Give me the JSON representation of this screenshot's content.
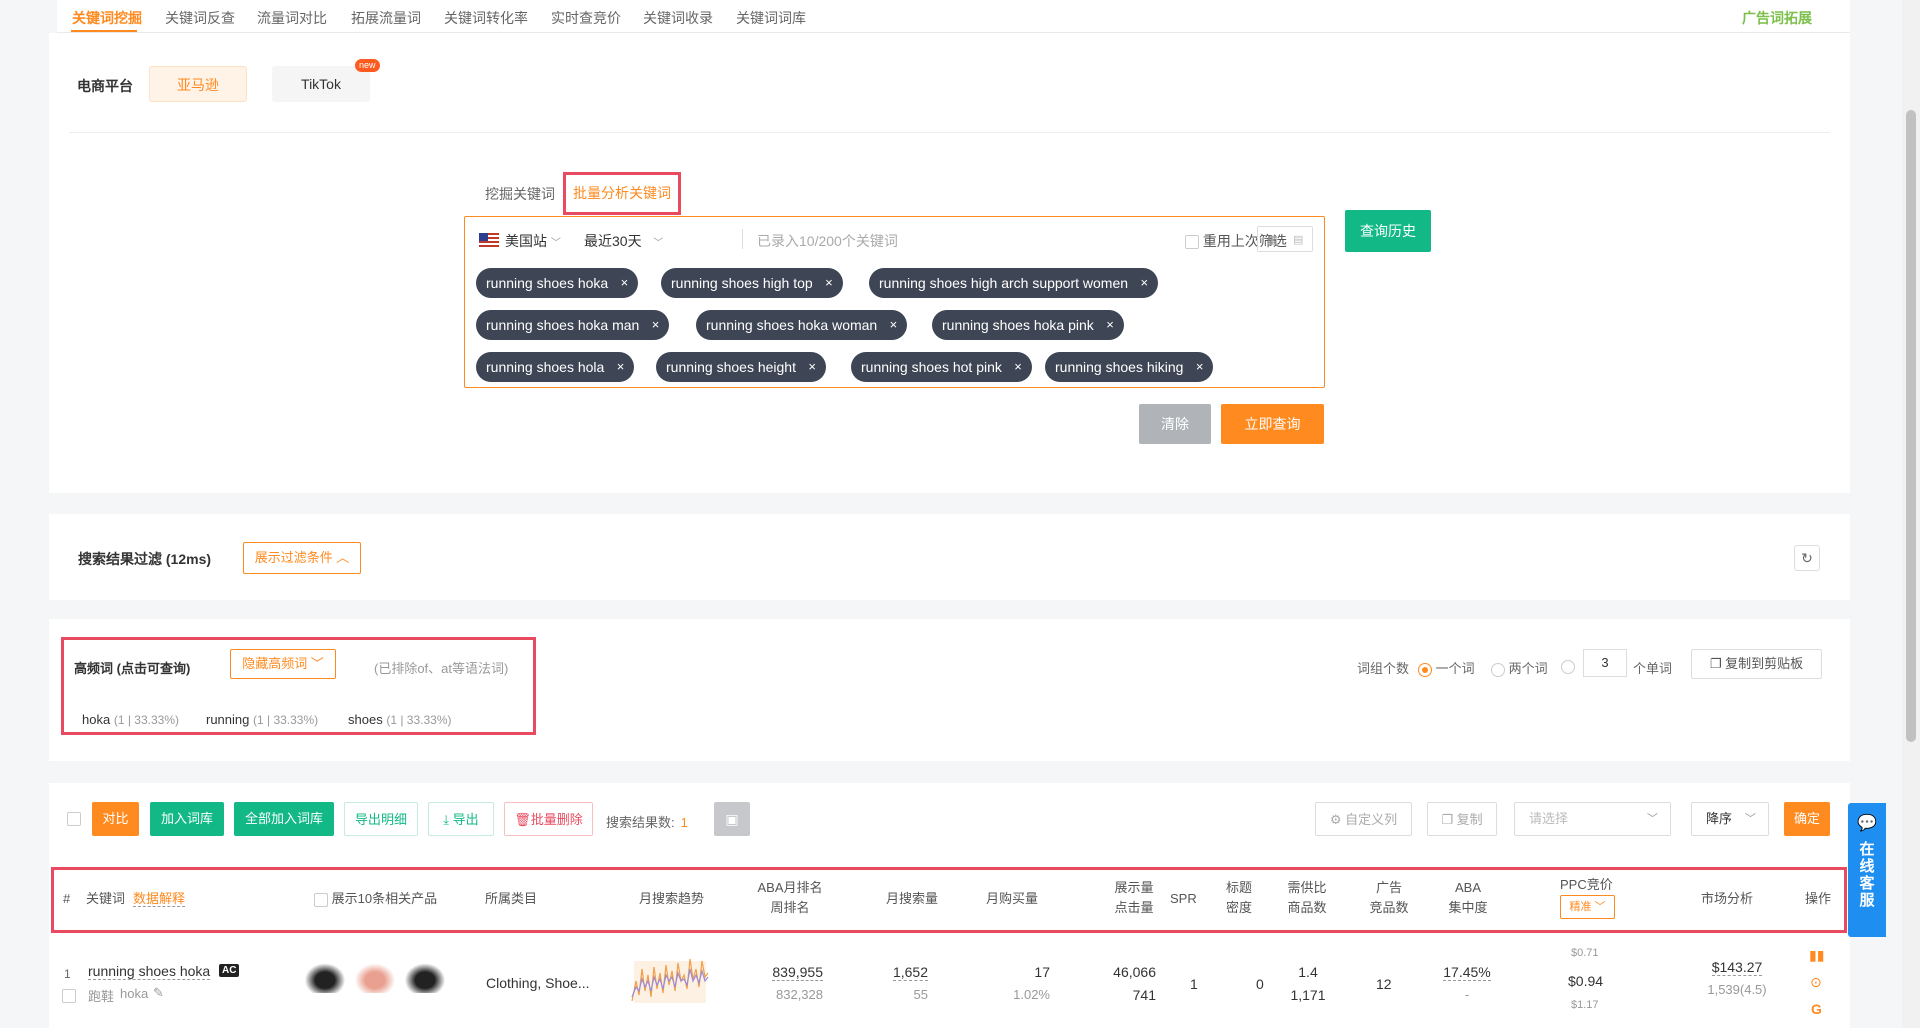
{
  "nav": {
    "tabs": [
      "关键词挖掘",
      "关键词反查",
      "流量词对比",
      "拓展流量词",
      "关键词转化率",
      "实时查竞价",
      "关键词收录",
      "关键词词库"
    ],
    "right_link": "广告词拓展"
  },
  "platform": {
    "label": "电商平台",
    "amazon": "亚马逊",
    "tiktok": "TikTok",
    "new_badge": "new"
  },
  "subtabs": {
    "mine": "挖掘关键词",
    "batch": "批量分析关键词"
  },
  "query": {
    "site": "美国站",
    "period": "最近30天",
    "placeholder": "已录入10/200个关键词",
    "reuse": "重用上次筛选",
    "tags": [
      "running shoes hoka",
      "running shoes high top",
      "running shoes high arch support women",
      "running shoes hoka man",
      "running shoes hoka woman",
      "running shoes hoka pink",
      "running shoes hola",
      "running shoes height",
      "running shoes hot pink",
      "running shoes hiking"
    ],
    "remove_icon": "×",
    "history_btn": "查询历史",
    "clear_btn": "清除",
    "submit_btn": "立即查询"
  },
  "filter": {
    "title": "搜索结果过滤 (12ms)",
    "toggle_btn": "展示过滤条件 ︿"
  },
  "high_freq": {
    "title": "高频词 (点击可查询)",
    "hide_btn": "隐藏高频词 ﹀",
    "note": "(已排除of、at等语法词)",
    "words": [
      {
        "word": "hoka",
        "stat": "(1 | 33.33%)"
      },
      {
        "word": "running",
        "stat": "(1 | 33.33%)"
      },
      {
        "word": "shoes",
        "stat": "(1 | 33.33%)"
      }
    ],
    "group_label": "词组个数",
    "one": "一个词",
    "two": "两个词",
    "n_value": "3",
    "n_suffix": "个单词",
    "copy_btn": "复制到剪贴板"
  },
  "toolbar": {
    "compare": "对比",
    "add_lib": "加入词库",
    "add_all": "全部加入词库",
    "export_detail": "导出明细",
    "export": "导出",
    "batch_delete": "批量删除",
    "result_label": "搜索结果数:",
    "result_count": "1",
    "custom_cols": "自定义列",
    "copy": "复制",
    "select_placeholder": "请选择",
    "order": "降序",
    "confirm": "确定"
  },
  "table_header": {
    "idx": "#",
    "keyword": "关键词",
    "data_explain": "数据解释",
    "show10": "展示10条相关产品",
    "category": "所属类目",
    "trend": "月搜索趋势",
    "aba_month": "ABA月排名",
    "aba_week": "周排名",
    "search_vol": "月搜索量",
    "purchase": "月购买量",
    "impressions": "展示量",
    "clicks": "点击量",
    "spr": "SPR",
    "title1": "标题",
    "title2": "密度",
    "ratio1": "需供比",
    "ratio2": "商品数",
    "ad1": "广告",
    "ad2": "竞品数",
    "aba1": "ABA",
    "aba2": "集中度",
    "ppc": "PPC竞价",
    "ppc_mode": "精准 ﹀",
    "market": "市场分析",
    "ops": "操作"
  },
  "row": {
    "idx": "1",
    "keyword": "running shoes hoka",
    "ac_badge": "AC",
    "cn": "跑鞋",
    "brand": "hoka",
    "category": "Clothing, Shoe...",
    "aba_month": "839,955",
    "aba_week": "832,328",
    "search_vol": "1,652",
    "search_vol_sub": "55",
    "purchase": "17",
    "purchase_pct": "1.02%",
    "impressions": "46,066",
    "clicks": "741",
    "spr": "1",
    "title_density": "0",
    "ratio": "1.4",
    "products": "1,171",
    "ad_comp": "12",
    "aba_conc": "17.45%",
    "aba_conc_sub": "-",
    "ppc_low": "$0.71",
    "ppc_mid": "$0.94",
    "ppc_high": "$1.17",
    "market_price": "$143.27",
    "market_sub": "1,539(4.5)"
  },
  "chat": {
    "label": "在线客服"
  }
}
